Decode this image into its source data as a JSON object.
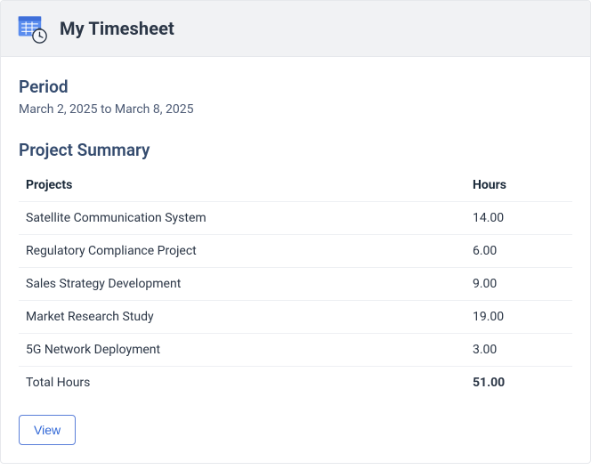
{
  "header": {
    "title": "My Timesheet"
  },
  "period": {
    "label": "Period",
    "value": "March 2, 2025 to March 8, 2025"
  },
  "summary": {
    "title": "Project Summary",
    "columns": {
      "projects": "Projects",
      "hours": "Hours"
    },
    "rows": [
      {
        "project": "Satellite Communication System",
        "hours": "14.00"
      },
      {
        "project": "Regulatory Compliance Project",
        "hours": "6.00"
      },
      {
        "project": "Sales Strategy Development",
        "hours": "9.00"
      },
      {
        "project": "Market Research Study",
        "hours": "19.00"
      },
      {
        "project": "5G Network Deployment",
        "hours": "3.00"
      }
    ],
    "total_label": "Total Hours",
    "total_hours": "51.00"
  },
  "actions": {
    "view": "View"
  },
  "chart_data": {
    "type": "table",
    "title": "Project Summary",
    "columns": [
      "Projects",
      "Hours"
    ],
    "rows": [
      [
        "Satellite Communication System",
        14.0
      ],
      [
        "Regulatory Compliance Project",
        6.0
      ],
      [
        "Sales Strategy Development",
        9.0
      ],
      [
        "Market Research Study",
        19.0
      ],
      [
        "5G Network Deployment",
        3.0
      ]
    ],
    "total": 51.0
  }
}
